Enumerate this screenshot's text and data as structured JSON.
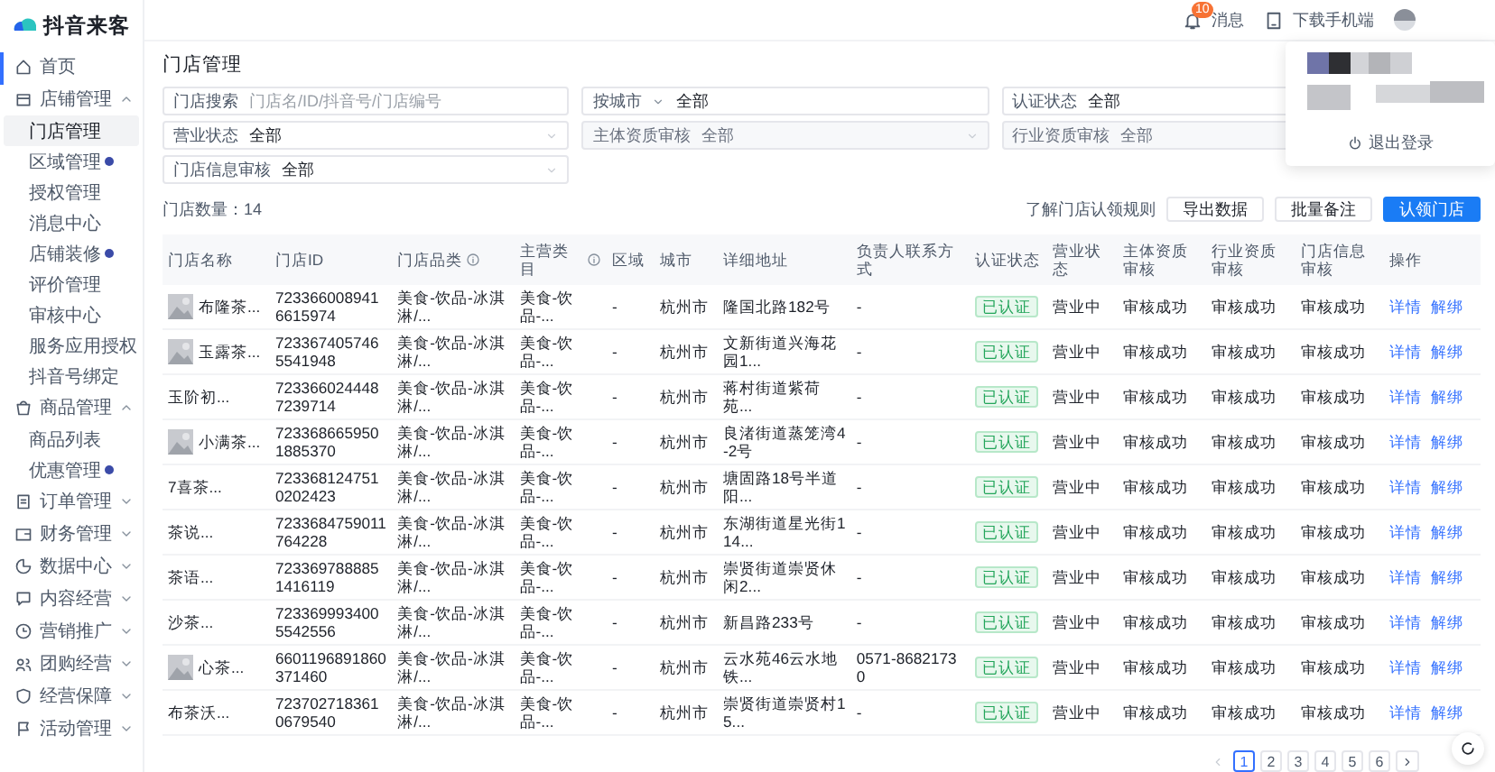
{
  "logo": {
    "text": "抖音来客"
  },
  "sidebar": {
    "items": [
      {
        "label": "首页"
      },
      {
        "label": "店铺管理",
        "expanded": true,
        "children": [
          {
            "label": "门店管理",
            "selected": true,
            "dot": false
          },
          {
            "label": "区域管理",
            "selected": false,
            "dot": true
          },
          {
            "label": "授权管理",
            "selected": false,
            "dot": false
          },
          {
            "label": "消息中心",
            "selected": false,
            "dot": false
          },
          {
            "label": "店铺装修",
            "selected": false,
            "dot": true
          },
          {
            "label": "评价管理",
            "selected": false,
            "dot": false
          },
          {
            "label": "审核中心",
            "selected": false,
            "dot": false
          },
          {
            "label": "服务应用授权",
            "selected": false,
            "dot": false
          },
          {
            "label": "抖音号绑定",
            "selected": false,
            "dot": false
          }
        ]
      },
      {
        "label": "商品管理",
        "expanded": true,
        "children": [
          {
            "label": "商品列表",
            "selected": false,
            "dot": false
          },
          {
            "label": "优惠管理",
            "selected": false,
            "dot": true
          }
        ]
      },
      {
        "label": "订单管理",
        "expanded": false
      },
      {
        "label": "财务管理",
        "expanded": false
      },
      {
        "label": "数据中心",
        "expanded": false
      },
      {
        "label": "内容经营",
        "expanded": false
      },
      {
        "label": "营销推广",
        "expanded": false
      },
      {
        "label": "团购经营",
        "expanded": false
      },
      {
        "label": "经营保障",
        "expanded": false
      },
      {
        "label": "活动管理",
        "expanded": false
      }
    ]
  },
  "topbar": {
    "notifications": {
      "label": "消息",
      "badge": "10"
    },
    "download": {
      "label": "下载手机端"
    }
  },
  "account_menu": {
    "logout": "退出登录"
  },
  "page_title": "门店管理",
  "filters": [
    {
      "kind": "text",
      "label": "门店搜索",
      "placeholder": "门店名/ID/抖音号/门店编号",
      "disabled": false
    },
    {
      "kind": "city",
      "label": "按城市",
      "value": "全部",
      "disabled": false
    },
    {
      "kind": "select",
      "label": "认证状态",
      "value": "全部",
      "disabled": false
    },
    {
      "kind": "select",
      "label": "营业状态",
      "value": "全部",
      "disabled": false
    },
    {
      "kind": "select",
      "label": "主体资质审核",
      "value": "全部",
      "disabled": true
    },
    {
      "kind": "select",
      "label": "行业资质审核",
      "value": "全部",
      "disabled": true
    },
    {
      "kind": "select",
      "label": "门店信息审核",
      "value": "全部",
      "disabled": false
    }
  ],
  "store_count": "门店数量：14",
  "actions": [
    {
      "kind": "link",
      "label": "了解门店认领规则"
    },
    {
      "kind": "default",
      "label": "导出数据"
    },
    {
      "kind": "default",
      "label": "批量备注"
    },
    {
      "kind": "primary",
      "label": "认领门店"
    }
  ],
  "table": {
    "columns": [
      {
        "label": "门店名称",
        "info": false
      },
      {
        "label": "门店ID",
        "info": false
      },
      {
        "label": "门店品类",
        "info": true
      },
      {
        "label": "主营类目",
        "info": true
      },
      {
        "label": "区域",
        "info": false
      },
      {
        "label": "城市",
        "info": false
      },
      {
        "label": "详细地址",
        "info": false
      },
      {
        "label": "负责人联系方式",
        "info": false
      },
      {
        "label": "认证状态",
        "info": false
      },
      {
        "label": "营业状态",
        "info": false
      },
      {
        "label": "主体资质审核",
        "info": false
      },
      {
        "label": "行业资质审核",
        "info": false
      },
      {
        "label": "门店信息审核",
        "info": false
      },
      {
        "label": "操作",
        "info": false
      }
    ],
    "rows": [
      {
        "has_thumbnail": true,
        "name": "布隆茶...",
        "id": "7233660089416615974",
        "category": "美食-饮品-冰淇淋/...",
        "main_category": "美食-饮品-...",
        "region": "-",
        "city": "杭州市",
        "address": "隆国北路182号",
        "contact": "-",
        "cert_status": "已认证",
        "business_status": "营业中",
        "audit_subject": "审核成功",
        "audit_industry": "审核成功",
        "audit_store": "审核成功",
        "actions": [
          "详情",
          "解绑"
        ]
      },
      {
        "has_thumbnail": true,
        "name": "玉露茶...",
        "id": "7233674057465541948",
        "category": "美食-饮品-冰淇淋/...",
        "main_category": "美食-饮品-...",
        "region": "-",
        "city": "杭州市",
        "address": "文新街道兴海花园1...",
        "contact": "-",
        "cert_status": "已认证",
        "business_status": "营业中",
        "audit_subject": "审核成功",
        "audit_industry": "审核成功",
        "audit_store": "审核成功",
        "actions": [
          "详情",
          "解绑"
        ]
      },
      {
        "has_thumbnail": false,
        "name": "玉阶初...",
        "id": "7233660244487239714",
        "category": "美食-饮品-冰淇淋/...",
        "main_category": "美食-饮品-...",
        "region": "-",
        "city": "杭州市",
        "address": "蒋村街道紫荷苑...",
        "contact": "-",
        "cert_status": "已认证",
        "business_status": "营业中",
        "audit_subject": "审核成功",
        "audit_industry": "审核成功",
        "audit_store": "审核成功",
        "actions": [
          "详情",
          "解绑"
        ]
      },
      {
        "has_thumbnail": true,
        "name": "小满茶...",
        "id": "7233686659501885370",
        "category": "美食-饮品-冰淇淋/...",
        "main_category": "美食-饮品-...",
        "region": "-",
        "city": "杭州市",
        "address": "良渚街道蒸笼湾4-2号",
        "contact": "-",
        "cert_status": "已认证",
        "business_status": "营业中",
        "audit_subject": "审核成功",
        "audit_industry": "审核成功",
        "audit_store": "审核成功",
        "actions": [
          "详情",
          "解绑"
        ]
      },
      {
        "has_thumbnail": false,
        "name": "7喜茶...",
        "id": "7233681247510202423",
        "category": "美食-饮品-冰淇淋/...",
        "main_category": "美食-饮品-...",
        "region": "-",
        "city": "杭州市",
        "address": "塘固路18号半道阳...",
        "contact": "-",
        "cert_status": "已认证",
        "business_status": "营业中",
        "audit_subject": "审核成功",
        "audit_industry": "审核成功",
        "audit_store": "审核成功",
        "actions": [
          "详情",
          "解绑"
        ]
      },
      {
        "has_thumbnail": false,
        "name": "茶说...",
        "id": "7233684759011764228",
        "category": "美食-饮品-冰淇淋/...",
        "main_category": "美食-饮品-...",
        "region": "-",
        "city": "杭州市",
        "address": "东湖街道星光街114...",
        "contact": "-",
        "cert_status": "已认证",
        "business_status": "营业中",
        "audit_subject": "审核成功",
        "audit_industry": "审核成功",
        "audit_store": "审核成功",
        "actions": [
          "详情",
          "解绑"
        ]
      },
      {
        "has_thumbnail": false,
        "name": "茶语...",
        "id": "7233697888851416119",
        "category": "美食-饮品-冰淇淋/...",
        "main_category": "美食-饮品-...",
        "region": "-",
        "city": "杭州市",
        "address": "崇贤街道崇贤休闲2...",
        "contact": "-",
        "cert_status": "已认证",
        "business_status": "营业中",
        "audit_subject": "审核成功",
        "audit_industry": "审核成功",
        "audit_store": "审核成功",
        "actions": [
          "详情",
          "解绑"
        ]
      },
      {
        "has_thumbnail": false,
        "name": "沙茶...",
        "id": "7233699934005542556",
        "category": "美食-饮品-冰淇淋/...",
        "main_category": "美食-饮品-...",
        "region": "-",
        "city": "杭州市",
        "address": "新昌路233号",
        "contact": "-",
        "cert_status": "已认证",
        "business_status": "营业中",
        "audit_subject": "审核成功",
        "audit_industry": "审核成功",
        "audit_store": "审核成功",
        "actions": [
          "详情",
          "解绑"
        ]
      },
      {
        "has_thumbnail": true,
        "name": "心茶...",
        "id": "6601196891860371460",
        "category": "美食-饮品-冰淇淋/...",
        "main_category": "美食-饮品-...",
        "region": "-",
        "city": "杭州市",
        "address": "云水苑46云水地铁...",
        "contact": "0571-86821730",
        "cert_status": "已认证",
        "business_status": "营业中",
        "audit_subject": "审核成功",
        "audit_industry": "审核成功",
        "audit_store": "审核成功",
        "actions": [
          "详情",
          "解绑"
        ]
      },
      {
        "has_thumbnail": false,
        "name": "布茶沃...",
        "id": "7237027183610679540",
        "category": "美食-饮品-冰淇淋/...",
        "main_category": "美食-饮品-...",
        "region": "-",
        "city": "杭州市",
        "address": "崇贤街道崇贤村15...",
        "contact": "-",
        "cert_status": "已认证",
        "business_status": "营业中",
        "audit_subject": "审核成功",
        "audit_industry": "审核成功",
        "audit_store": "审核成功",
        "actions": [
          "详情",
          "解绑"
        ]
      }
    ]
  },
  "pagination": {
    "pages": [
      {
        "label": "1",
        "selected": true
      },
      {
        "label": "2",
        "selected": false
      },
      {
        "label": "3",
        "selected": false
      },
      {
        "label": "4",
        "selected": false
      },
      {
        "label": "5",
        "selected": false
      },
      {
        "label": "6",
        "selected": false
      }
    ]
  }
}
